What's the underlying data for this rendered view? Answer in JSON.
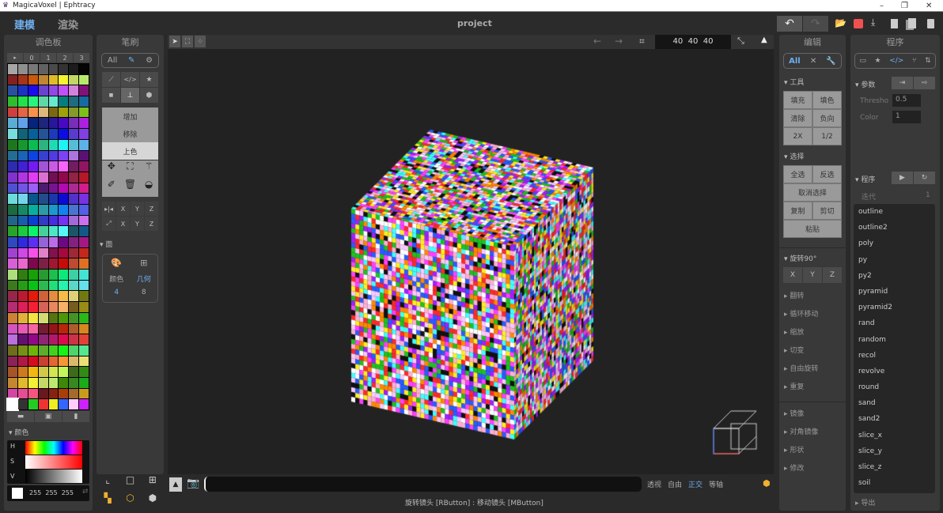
{
  "window": {
    "title": "MagicaVoxel | Ephtracy",
    "minimize": "–",
    "restore": "❐",
    "close": "✕"
  },
  "topbar": {
    "mode_model": "建模",
    "mode_render": "渲染",
    "project": "project",
    "undo": "↶",
    "redo": "↷",
    "accent": "#6fb0f0",
    "save_color": "#f05050"
  },
  "palette": {
    "title": "调色板",
    "tabs": [
      "▸",
      "0",
      "1",
      "2",
      "3"
    ],
    "color_section": "颜色",
    "h": "H",
    "s": "S",
    "v": "V",
    "rgb": "255  255  255"
  },
  "brush": {
    "title": "笔刷",
    "all": "All",
    "modes": [
      "增加",
      "移除",
      "上色"
    ],
    "axis1": [
      "X",
      "Y",
      "Z"
    ],
    "axis2": [
      "X",
      "Y",
      "Z"
    ],
    "face_section": "面",
    "face_color": "颜色",
    "face_geo": "几何",
    "face_color_n": "4",
    "face_geo_n": "8"
  },
  "viewport": {
    "size": "40  40  40",
    "views": [
      "透视",
      "自由",
      "正交",
      "等轴"
    ],
    "active_view": "正交",
    "status": "旋转镜头 [RButton] : 移动镜头 [MButton]"
  },
  "edit": {
    "title": "编辑",
    "all": "All",
    "tools": "工具",
    "tool_buttons": [
      "填充",
      "填色",
      "清除",
      "负向",
      "2X",
      "1/2"
    ],
    "select": "选择",
    "select_buttons": [
      "全选",
      "反选"
    ],
    "deselect": "取消选择",
    "copy": "复制",
    "cut": "剪切",
    "paste": "粘贴",
    "rotate": "旋转90°",
    "rot_axes": [
      "X",
      "Y",
      "Z"
    ],
    "sections": [
      "翻转",
      "循环移动",
      "缩放",
      "切变",
      "自由旋转",
      "重复"
    ],
    "sections2": [
      "镜像",
      "对角镜像",
      "形状",
      "修改"
    ]
  },
  "program": {
    "title": "程序",
    "params": "参数",
    "param_rows": [
      {
        "label": "Thresho",
        "value": "0.5"
      },
      {
        "label": "Color",
        "value": "1"
      }
    ],
    "prog": "程序",
    "iter": "迭代",
    "iter_value": "1",
    "items": [
      "outline",
      "outline2",
      "poly",
      "py",
      "py2",
      "pyramid",
      "pyramid2",
      "rand",
      "random",
      "recol",
      "revolve",
      "round",
      "sand",
      "sand2",
      "slice_x",
      "slice_y",
      "slice_z",
      "soil"
    ],
    "export": "导出"
  }
}
